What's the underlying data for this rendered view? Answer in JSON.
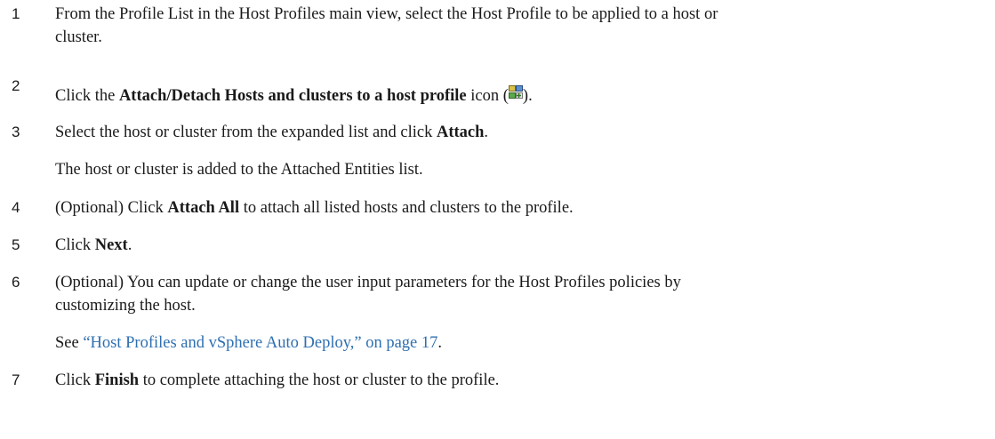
{
  "steps": [
    {
      "num": "1",
      "line1": "From the Profile List in the Host Profiles main view, select the Host Profile to be applied to a host or",
      "line2": "cluster."
    },
    {
      "num": "2",
      "pre": "Click the ",
      "bold": "Attach/Detach Hosts and clusters to a host profile",
      "mid": " icon (",
      "icon": "attach-detach-hosts-icon",
      "post": ")."
    },
    {
      "num": "3",
      "pre": "Select the host or cluster from the expanded list and click ",
      "bold": "Attach",
      "post": "."
    },
    {
      "num": "4",
      "pre": "(Optional) Click ",
      "bold": "Attach All",
      "post": " to attach all listed hosts and clusters to the profile."
    },
    {
      "num": "5",
      "pre": "Click ",
      "bold": "Next",
      "post": "."
    },
    {
      "num": "6",
      "line1": "(Optional) You can update or change the user input parameters for the Host Profiles policies by",
      "line2": "customizing the host."
    },
    {
      "num": "7",
      "pre": "Click ",
      "bold": "Finish",
      "post": " to complete attaching the host or cluster to the profile."
    }
  ],
  "notes": {
    "step3_result": "The host or cluster is added to the Attached Entities list.",
    "step6_see": "See ",
    "step6_link": "“Host Profiles and vSphere Auto Deploy,” on page 17",
    "step6_end": "."
  }
}
